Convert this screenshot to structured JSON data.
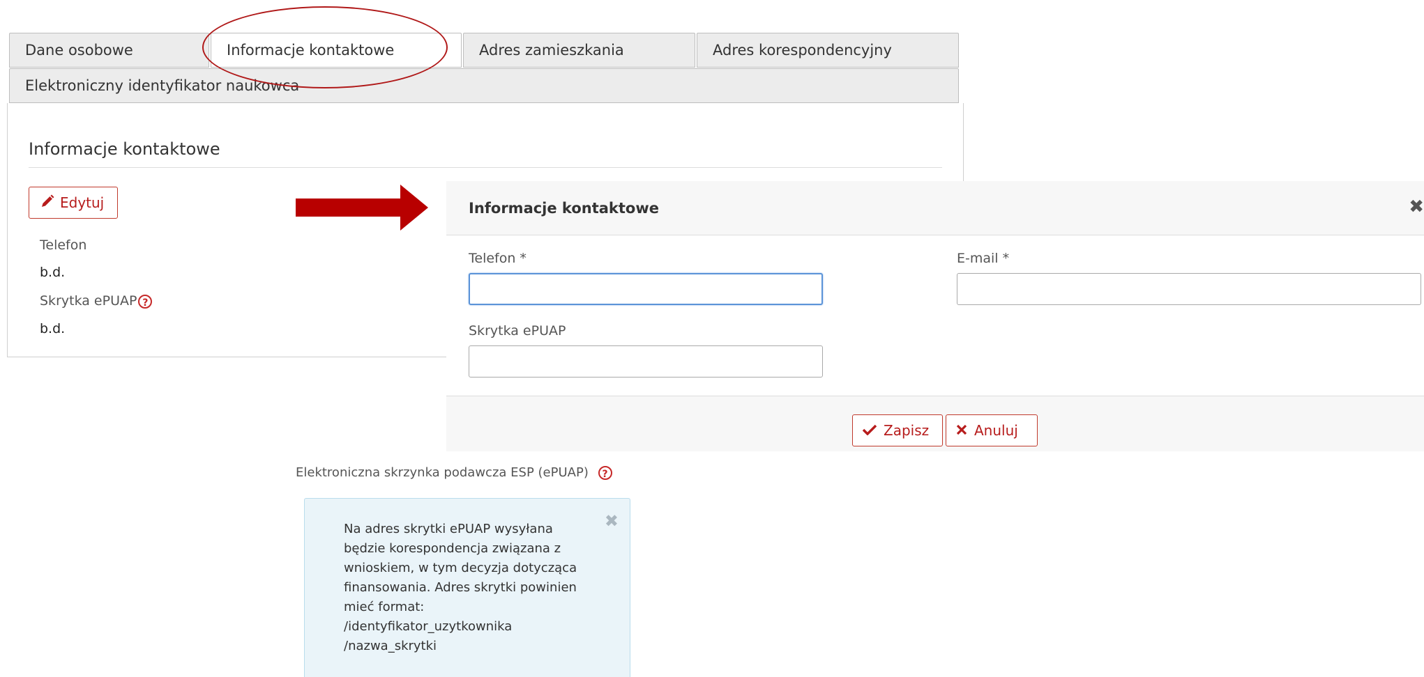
{
  "tabs": [
    {
      "label": "Dane osobowe",
      "active": false
    },
    {
      "label": "Informacje kontaktowe",
      "active": true
    },
    {
      "label": "Adres zamieszkania",
      "active": false
    },
    {
      "label": "Adres korespondencyjny",
      "active": false
    },
    {
      "label": "Elektroniczny identyfikator naukowca",
      "active": false
    }
  ],
  "panel": {
    "title": "Informacje kontaktowe",
    "edit_button": "Edytuj",
    "fields": [
      {
        "label": "Telefon",
        "value": "b.d."
      },
      {
        "label": "Skrytka ePUAP",
        "value": "b.d.",
        "help_icon": "question-circle-icon"
      }
    ]
  },
  "modal": {
    "title": "Informacje kontaktowe",
    "close_icon": "close-icon",
    "fields": {
      "phone": {
        "label": "Telefon *",
        "value": ""
      },
      "email": {
        "label": "E-mail *",
        "value": ""
      },
      "epuap": {
        "label": "Skrytka ePUAP",
        "value": ""
      }
    },
    "save_button": "Zapisz",
    "cancel_button": "Anuluj"
  },
  "help": {
    "label": "Elektroniczna skrzynka podawcza ESP (ePUAP)",
    "text": "Na adres skrytki ePUAP wysyłana będzie korespondencja związana z wnioskiem, w tym decyzja dotycząca finansowania. Adres skrytki powinien mieć format: /identyfikator_uzytkownika /nazwa_skrytki"
  },
  "colors": {
    "accent_red": "#b71c1c",
    "arrow_red": "#b80000",
    "focus_blue": "#5b93d8",
    "alert_bg": "#eaf4f9"
  }
}
